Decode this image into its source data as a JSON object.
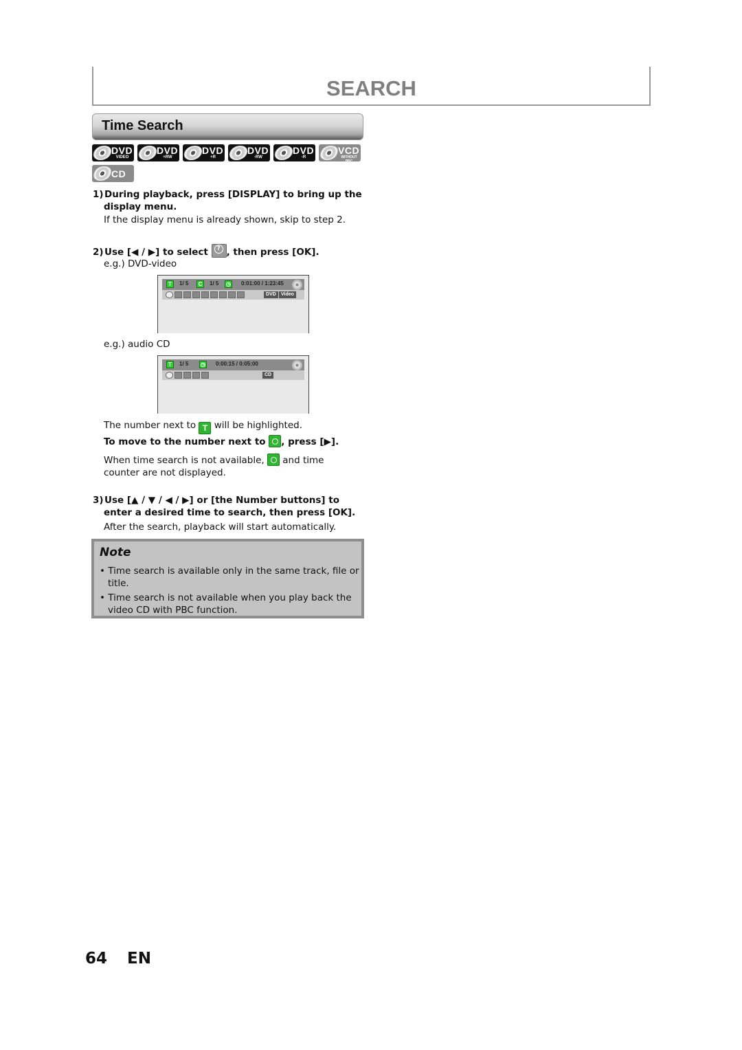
{
  "header": {
    "title": "SEARCH"
  },
  "section": {
    "title": "Time Search"
  },
  "disc_badges": [
    {
      "main": "DVD",
      "sub": "VIDEO",
      "style": "dark"
    },
    {
      "main": "DVD",
      "sub": "+RW",
      "style": "dark"
    },
    {
      "main": "DVD",
      "sub": "+R",
      "style": "dark"
    },
    {
      "main": "DVD",
      "sub": "-RW",
      "style": "dark"
    },
    {
      "main": "DVD",
      "sub": "-R",
      "style": "dark"
    },
    {
      "main": "VCD",
      "sub": "WITHOUT PBC",
      "style": "gray"
    },
    {
      "main": "CD",
      "sub": "",
      "style": "gray"
    }
  ],
  "steps": {
    "step1": {
      "number": "1)",
      "heading_line1": "During playback, press [DISPLAY] to bring up the",
      "heading_line2": "display menu.",
      "body": "If the display menu is already shown, skip to step 2."
    },
    "step2": {
      "number": "2)",
      "heading_pre": "Use [◀ / ▶] to select",
      "heading_post": ", then press [OK].",
      "example_dvd": "e.g.) DVD-video",
      "example_cd": "e.g.) audio CD",
      "highlight_pre": "The number next to",
      "highlight_post": "will be highlighted.",
      "move_pre": "To move to the number next to",
      "move_post": ", press [▶].",
      "unavailable_pre": "When time search is not available,",
      "unavailable_post": "and time",
      "unavailable_line2": "counter are not displayed."
    },
    "step3": {
      "number": "3)",
      "heading_line1": "Use [▲ / ▼ / ◀ / ▶] or [the Number buttons] to",
      "heading_line2": "enter a desired time to search, then press [OK].",
      "body": "After the search, playback will start automatically."
    }
  },
  "osd_dvd": {
    "title_icon": "T",
    "title_num": "1/   5",
    "chapter_icon": "C",
    "chapter_num": "1/   5",
    "time": "0:01:00 / 1:23:45",
    "labels": [
      "DVD",
      "Video"
    ]
  },
  "osd_cd": {
    "title_icon": "T",
    "track_num": "1/   5",
    "time": "0:00:15 / 0:05:00",
    "labels": [
      "CD"
    ]
  },
  "icons": {
    "title": "T"
  },
  "note": {
    "title": "Note",
    "items": [
      "• Time search is available only in the same track, file or title.",
      "• Time search is not available when you play back the video CD with PBC function."
    ]
  },
  "footer": {
    "page_number": "64",
    "language": "EN"
  }
}
